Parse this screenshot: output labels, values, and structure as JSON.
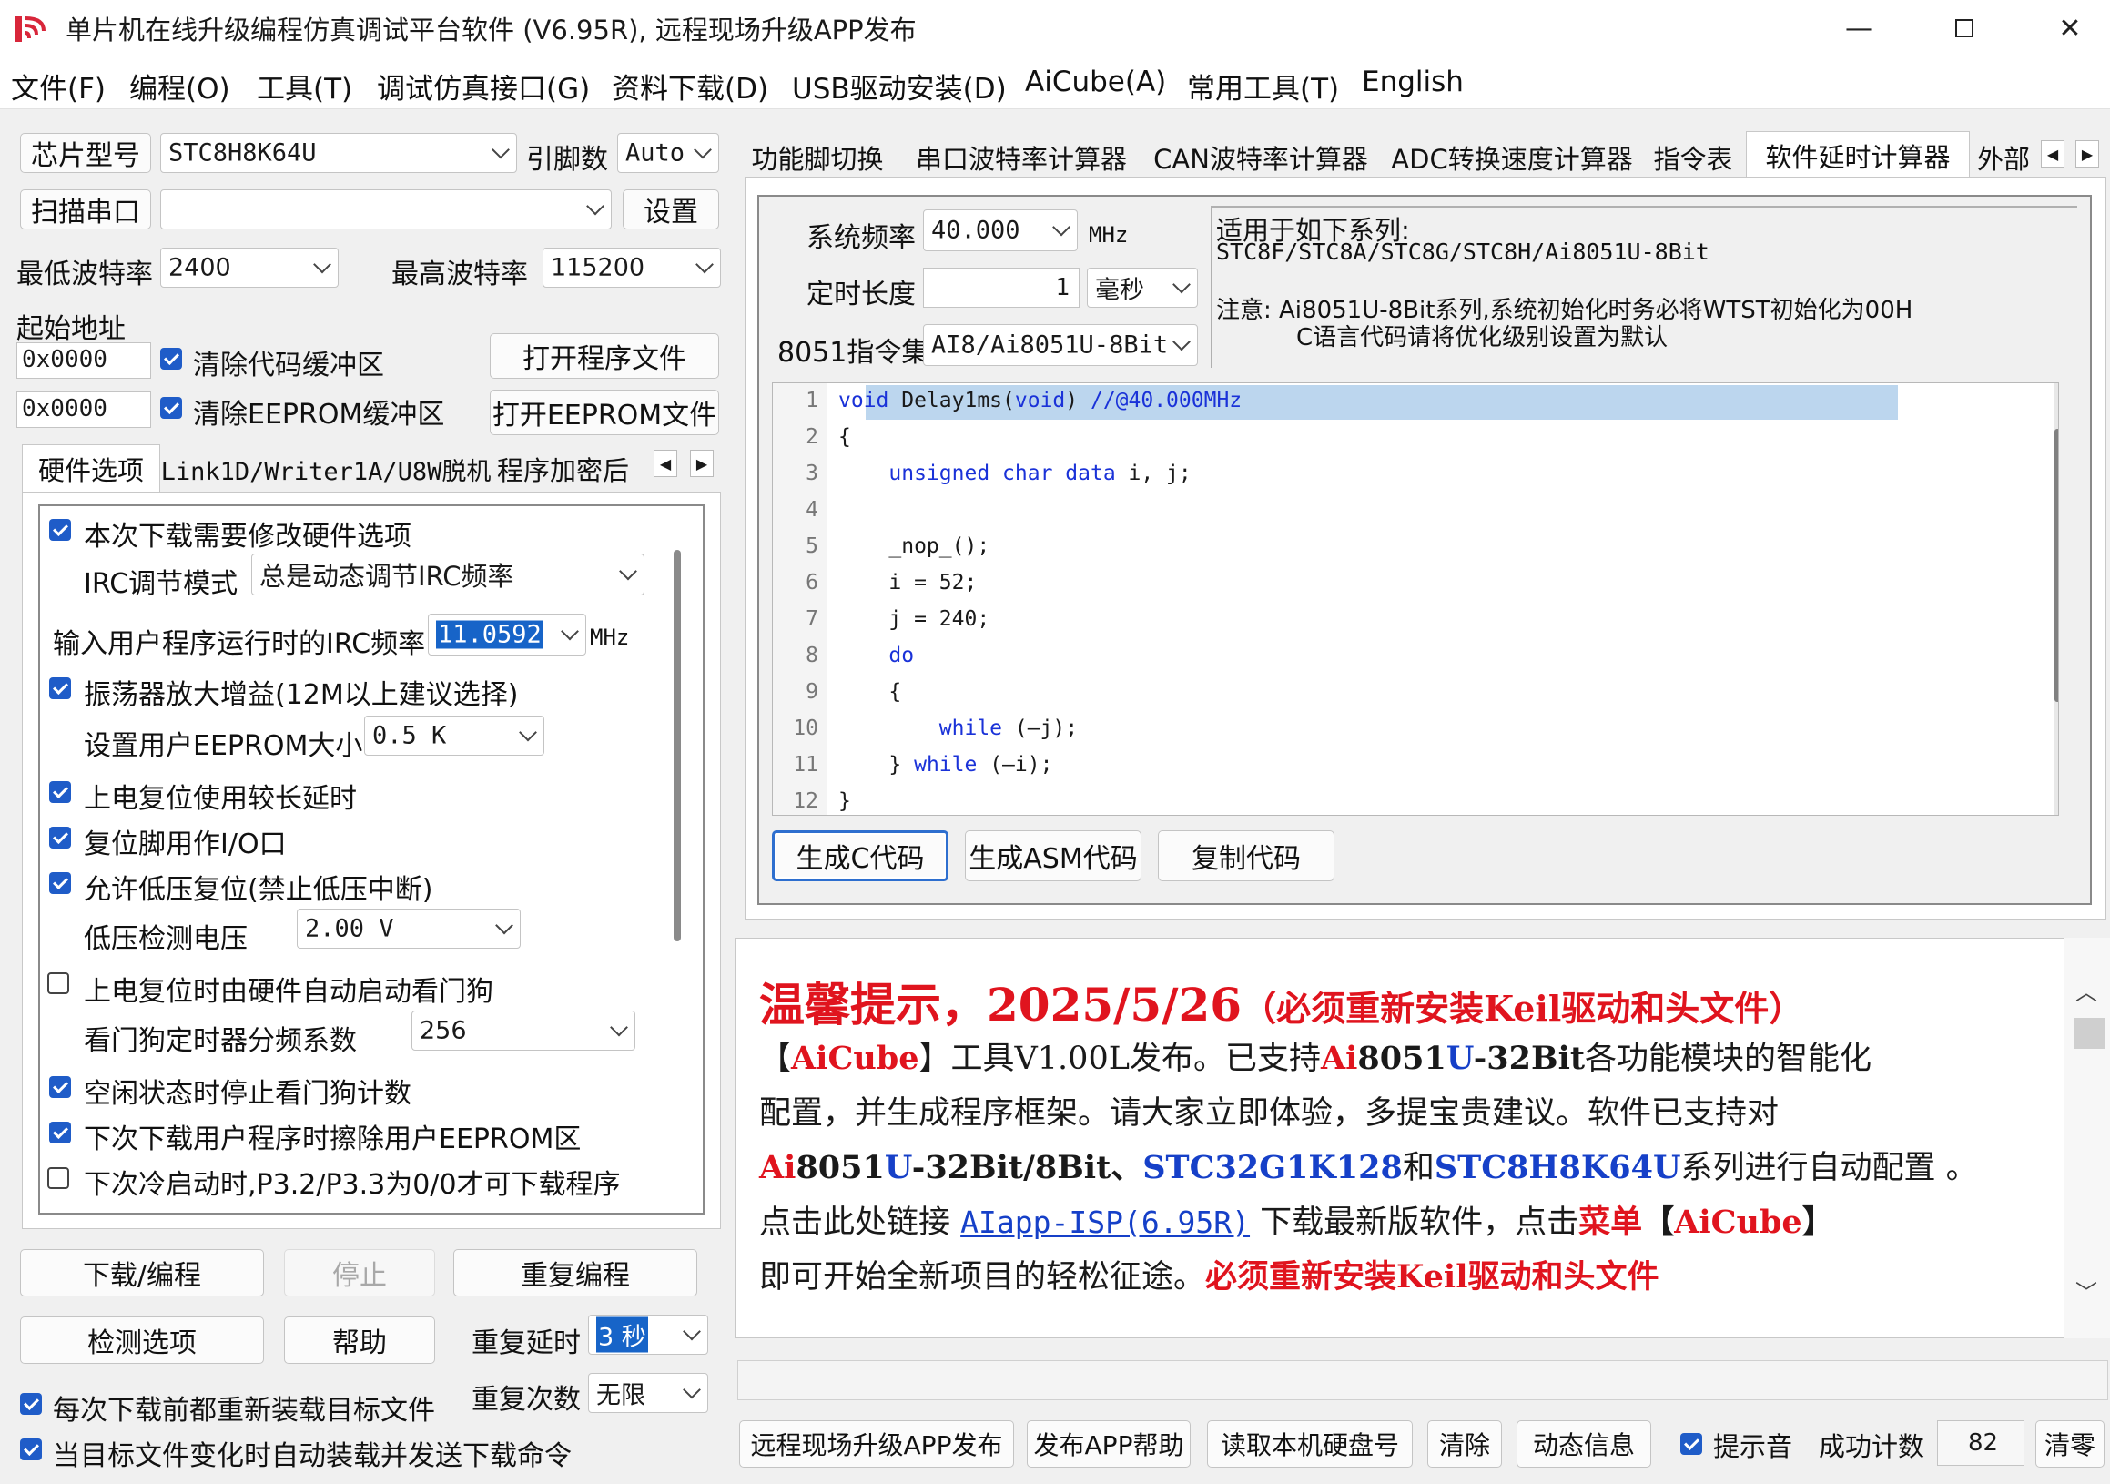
{
  "window": {
    "title": "单片机在线升级编程仿真调试平台软件 (V6.95R), 远程现场升级APP发布"
  },
  "menu": [
    "文件(F)",
    "编程(O)",
    "工具(T)",
    "调试仿真接口(G)",
    "资料下载(D)",
    "USB驱动安装(D)",
    "AiCube(A)",
    "常用工具(T)",
    "English"
  ],
  "left": {
    "chip_type_btn": "芯片型号",
    "chip_value": "STC8H8K64U",
    "pins_label": "引脚数",
    "pins_value": "Auto",
    "scan_btn": "扫描串口",
    "port_value": "",
    "settings_btn": "设置",
    "min_baud_label": "最低波特率",
    "min_baud_value": "2400",
    "max_baud_label": "最高波特率",
    "max_baud_value": "115200",
    "start_addr_label": "起始地址",
    "addr1": "0x0000",
    "clear_code_label": "清除代码缓冲区",
    "open_prog_btn": "打开程序文件",
    "addr2": "0x0000",
    "clear_eeprom_label": "清除EEPROM缓冲区",
    "open_eeprom_btn": "打开EEPROM文件",
    "tabs": [
      "硬件选项",
      "Link1D/Writer1A/U8W脱机",
      "程序加密后"
    ],
    "hw": {
      "opt_modify": "本次下载需要修改硬件选项",
      "irc_mode_label": "IRC调节模式",
      "irc_mode_value": "总是动态调节IRC频率",
      "irc_freq_label": "输入用户程序运行时的IRC频率",
      "irc_freq_value": "11.0592",
      "irc_freq_unit": "MHz",
      "osc_gain": "振荡器放大增益(12M以上建议选择)",
      "eeprom_size_label": "设置用户EEPROM大小",
      "eeprom_size_value": "0.5 K",
      "long_delay": "上电复位使用较长延时",
      "reset_io": "复位脚用作I/O口",
      "lvr": "允许低压复位(禁止低压中断)",
      "lv_label": "低压检测电压",
      "lv_value": "2.00 V",
      "wdt_auto": "上电复位时由硬件自动启动看门狗",
      "wdt_div_label": "看门狗定时器分频系数",
      "wdt_div_value": "256",
      "wdt_idle": "空闲状态时停止看门狗计数",
      "erase_eeprom": "下次下载用户程序时擦除用户EEPROM区",
      "cold_boot": "下次冷启动时,P3.2/P3.3为0/0才可下载程序"
    },
    "download_btn": "下载/编程",
    "stop_btn": "停止",
    "repeat_btn": "重复编程",
    "check_btn": "检测选项",
    "help_btn": "帮助",
    "repeat_delay_label": "重复延时",
    "repeat_delay_value": "3 秒",
    "repeat_count_label": "重复次数",
    "repeat_count_value": "无限",
    "reload_label": "每次下载前都重新装载目标文件",
    "autosend_label": "当目标文件变化时自动装载并发送下载命令"
  },
  "right": {
    "tabs": [
      "功能脚切换",
      "串口波特率计算器",
      "CAN波特率计算器",
      "ADC转换速度计算器",
      "指令表",
      "软件延时计算器",
      "外部"
    ],
    "sysclk_label": "系统频率",
    "sysclk_value": "40.000",
    "sysclk_unit": "MHz",
    "duration_label": "定时长度",
    "duration_value": "1",
    "duration_unit": "毫秒",
    "isa_label": "8051指令集",
    "isa_value": "AI8/Ai8051U-8Bit",
    "info_title": "适用于如下系列:",
    "info_series": "STC8F/STC8A/STC8G/STC8H/Ai8051U-8Bit",
    "info_note1": "注意: Ai8051U-8Bit系列,系统初始化时务必将WTST初始化为00H",
    "info_note2": "C语言代码请将优化级别设置为默认",
    "code": [
      {
        "n": "1",
        "t": "void Delay1ms(void) //@40.000MHz"
      },
      {
        "n": "2",
        "t": "{"
      },
      {
        "n": "3",
        "t": "    unsigned char data i, j;"
      },
      {
        "n": "4",
        "t": ""
      },
      {
        "n": "5",
        "t": "    _nop_();"
      },
      {
        "n": "6",
        "t": "    i = 52;"
      },
      {
        "n": "7",
        "t": "    j = 240;"
      },
      {
        "n": "8",
        "t": "    do"
      },
      {
        "n": "9",
        "t": "    {"
      },
      {
        "n": "10",
        "t": "        while (—j);"
      },
      {
        "n": "11",
        "t": "    } while (—i);"
      },
      {
        "n": "12",
        "t": "}"
      }
    ],
    "gen_c_btn": "生成C代码",
    "gen_asm_btn": "生成ASM代码",
    "copy_btn": "复制代码",
    "notice": {
      "heading": "温馨提示，2025/5/26",
      "heading_sub": "（必须重新安装Keil驱动和头文件）",
      "l1a": "【",
      "l1b": "AiCube",
      "l1c": "】工具V1.00L发布。已支持",
      "l1d": "Ai",
      "l1e": "8051",
      "l1f": "U",
      "l1g": "-32Bit",
      "l1h": "各功能模块的智能化",
      "l2": "配置，并生成程序框架。请大家立即体验，多提宝贵建议。软件已支持对",
      "l3a": "Ai",
      "l3b": "8051",
      "l3c": "U",
      "l3d": "-32Bit/8Bit、",
      "l3e": "STC32G1K128",
      "l3f": "和",
      "l3g": "STC8H8K64U",
      "l3h": "系列进行自动配置 。",
      "l4a": "点击此处链接 ",
      "l4b": "AIapp-ISP(6.95R)",
      "l4c": " 下载最新版软件，点击",
      "l4d": "菜单",
      "l4e": "【",
      "l4f": "AiCube",
      "l4g": "】",
      "l5a": "即可开始全新项目的轻松征途。",
      "l5b": "必须重新安装Keil驱动和头文件"
    },
    "bottom": {
      "publish_btn": "远程现场升级APP发布",
      "help_btn": "发布APP帮助",
      "disk_btn": "读取本机硬盘号",
      "clear_btn": "清除",
      "dyn_btn": "动态信息",
      "sound_label": "提示音",
      "success_label": "成功计数",
      "success_value": "82",
      "reset_btn": "清零"
    }
  },
  "colors": {
    "accent": "#1f5cc8",
    "notice_red": "#e0141e",
    "notice_blue": "#1640c8"
  }
}
